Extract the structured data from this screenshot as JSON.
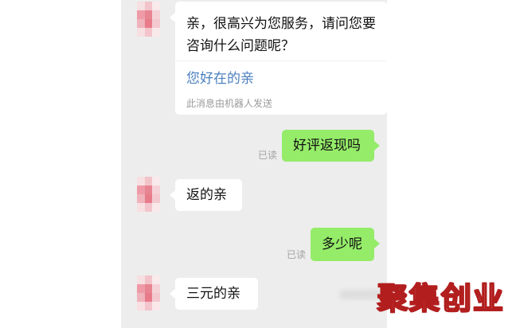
{
  "chat": {
    "messages": [
      {
        "type": "received-card",
        "text": "亲，很高兴为您服务，请问您要咨询什么问题呢？",
        "link": "您好在的亲",
        "note": "此消息由机器人发送"
      },
      {
        "type": "sent",
        "text": "好评返现吗",
        "status": "已读"
      },
      {
        "type": "received",
        "text": "返的亲"
      },
      {
        "type": "sent",
        "text": "多少呢",
        "status": "已读"
      },
      {
        "type": "received",
        "text": "三元的亲"
      }
    ]
  },
  "watermark": {
    "text": "聚集创业"
  },
  "colors": {
    "sent_bubble": "#95ec69",
    "received_bubble": "#ffffff",
    "chat_background": "#ededed",
    "link": "#4a7fbe",
    "watermark_stroke": "#b21e1e"
  },
  "icons": {
    "avatar": "pixelated-avatar-icon"
  }
}
